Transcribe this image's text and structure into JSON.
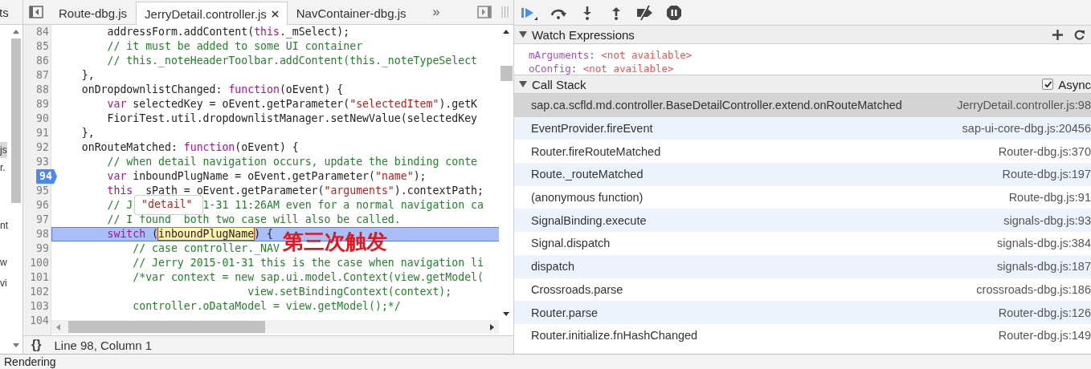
{
  "navigator": {
    "tab": "ts",
    "items": [
      {
        "label": "js",
        "selected": true
      },
      {
        "label": "r.",
        "selected": false
      },
      {
        "label": "nt",
        "selected": false
      },
      {
        "label": "w",
        "selected": false
      },
      {
        "label": "vi",
        "selected": false
      }
    ]
  },
  "tabs": [
    {
      "label": "Route-dbg.js",
      "selected": false,
      "closable": false
    },
    {
      "label": "JerryDetail.controller.js",
      "selected": true,
      "closable": true
    },
    {
      "label": "NavContainer-dbg.js",
      "selected": false,
      "closable": false
    }
  ],
  "tabs_overflow": "»",
  "code": {
    "lines": [
      {
        "number": "84",
        "breakpoint": false,
        "current": false,
        "tokens": [
          {
            "kind": "plain",
            "text": "        addressForm.addContent("
          },
          {
            "kind": "keyword",
            "text": "this"
          },
          {
            "kind": "plain",
            "text": "._mSelect);"
          }
        ]
      },
      {
        "number": "85",
        "breakpoint": false,
        "current": false,
        "tokens": [
          {
            "kind": "comment",
            "text": "        // it must be added to some UI container"
          }
        ]
      },
      {
        "number": "86",
        "breakpoint": false,
        "current": false,
        "tokens": [
          {
            "kind": "comment",
            "text": "        // this._noteHeaderToolbar.addContent(this._noteTypeSelect"
          }
        ]
      },
      {
        "number": "87",
        "breakpoint": false,
        "current": false,
        "tokens": [
          {
            "kind": "plain",
            "text": "    },"
          }
        ]
      },
      {
        "number": "88",
        "breakpoint": false,
        "current": false,
        "tokens": [
          {
            "kind": "plain",
            "text": "    onDropdownlistChanged: "
          },
          {
            "kind": "keyword",
            "text": "function"
          },
          {
            "kind": "plain",
            "text": "(oEvent) {"
          }
        ]
      },
      {
        "number": "89",
        "breakpoint": false,
        "current": false,
        "tokens": [
          {
            "kind": "keyword",
            "text": "        var"
          },
          {
            "kind": "plain",
            "text": " selectedKey = oEvent.getParameter("
          },
          {
            "kind": "string",
            "text": "\"selectedItem\""
          },
          {
            "kind": "plain",
            "text": ").getK"
          }
        ]
      },
      {
        "number": "90",
        "breakpoint": false,
        "current": false,
        "tokens": [
          {
            "kind": "plain",
            "text": "        FioriTest.util.dropdownlistManager.setNewValue(selectedKey"
          }
        ]
      },
      {
        "number": "91",
        "breakpoint": false,
        "current": false,
        "tokens": [
          {
            "kind": "plain",
            "text": "    },"
          }
        ]
      },
      {
        "number": "92",
        "breakpoint": false,
        "current": false,
        "tokens": [
          {
            "kind": "plain",
            "text": "    onRouteMatched: "
          },
          {
            "kind": "keyword",
            "text": "function"
          },
          {
            "kind": "plain",
            "text": "(oEvent) {"
          }
        ]
      },
      {
        "number": "93",
        "breakpoint": false,
        "current": false,
        "tokens": [
          {
            "kind": "comment",
            "text": "        // when detail navigation occurs, update the binding conte"
          }
        ]
      },
      {
        "number": "94",
        "breakpoint": true,
        "current": false,
        "tokens": [
          {
            "kind": "keyword",
            "text": "        var"
          },
          {
            "kind": "plain",
            "text": " inboundPlugName = oEvent.getParameter("
          },
          {
            "kind": "string",
            "text": "\"name\""
          },
          {
            "kind": "plain",
            "text": ");"
          }
        ]
      },
      {
        "number": "95",
        "breakpoint": false,
        "current": false,
        "tokens": [
          {
            "kind": "keyword",
            "text": "        this"
          },
          {
            "kind": "plain",
            "text": "  sPath = oEvent.getParameter("
          },
          {
            "kind": "string",
            "text": "\"arguments\""
          },
          {
            "kind": "plain",
            "text": ").contextPath;"
          }
        ]
      },
      {
        "number": "96",
        "breakpoint": false,
        "current": false,
        "tokens": [
          {
            "kind": "comment",
            "text": "        // J"
          },
          {
            "kind": "comment",
            "text": "1-31 11:26AM even for a normal navigation ca",
            "after_gap": true
          }
        ]
      },
      {
        "number": "97",
        "breakpoint": false,
        "current": false,
        "tokens": [
          {
            "kind": "comment",
            "text": "        // I found  both two case will also be called."
          }
        ]
      },
      {
        "number": "98",
        "breakpoint": false,
        "current": true,
        "tokens": [
          {
            "kind": "keyword",
            "text": "        switch"
          },
          {
            "kind": "plain",
            "text": " ("
          },
          {
            "kind": "match",
            "text": "inboundPlugName"
          },
          {
            "kind": "plain",
            "text": ") {"
          }
        ]
      },
      {
        "number": "99",
        "breakpoint": false,
        "current": false,
        "tokens": [
          {
            "kind": "comment",
            "text": "            // case controller._NAV"
          }
        ]
      },
      {
        "number": "100",
        "breakpoint": false,
        "current": false,
        "tokens": [
          {
            "kind": "comment",
            "text": "            // Jerry 2015-01-31 this is the case when navigation li"
          }
        ]
      },
      {
        "number": "101",
        "breakpoint": false,
        "current": false,
        "tokens": [
          {
            "kind": "comment",
            "text": "            /*var context = new sap.ui.model.Context(view.getModel("
          }
        ]
      },
      {
        "number": "102",
        "breakpoint": false,
        "current": false,
        "tokens": [
          {
            "kind": "comment",
            "text": "                              view.setBindingContext(context);"
          }
        ]
      },
      {
        "number": "103",
        "breakpoint": false,
        "current": false,
        "tokens": [
          {
            "kind": "comment",
            "text": "            controller.oDataModel = view.getModel();*/"
          }
        ]
      },
      {
        "number": "104",
        "breakpoint": false,
        "current": false
      }
    ]
  },
  "tooltip": "\"detail\"",
  "annotation": "第三次触发",
  "status_bar": {
    "format_button": "{}",
    "position": "Line 98, Column 1"
  },
  "drawer_tab": "Rendering",
  "watch": {
    "title": "Watch Expressions",
    "items": [
      {
        "name": "mArguments",
        "separator": ":",
        "value": "<not available>"
      },
      {
        "name": "oConfig",
        "separator": ":",
        "value": "<not available>"
      }
    ]
  },
  "call_stack": {
    "title": "Call Stack",
    "async_label": "Async",
    "async_checked": true,
    "frames": [
      {
        "function": "sap.ca.scfld.md.controller.BaseDetailController.extend.onRouteMatched",
        "location": "JerryDetail.controller.js:98",
        "selected": true
      },
      {
        "function": "EventProvider.fireEvent",
        "location": "sap-ui-core-dbg.js:20456",
        "selected": false
      },
      {
        "function": "Router.fireRouteMatched",
        "location": "Router-dbg.js:370",
        "selected": false
      },
      {
        "function": "Route._routeMatched",
        "location": "Route-dbg.js:197",
        "selected": false
      },
      {
        "function": "(anonymous function)",
        "location": "Route-dbg.js:91",
        "selected": false
      },
      {
        "function": "SignalBinding.execute",
        "location": "signals-dbg.js:93",
        "selected": false
      },
      {
        "function": "Signal.dispatch",
        "location": "signals-dbg.js:384",
        "selected": false
      },
      {
        "function": "dispatch",
        "location": "signals-dbg.js:187",
        "selected": false
      },
      {
        "function": "Crossroads.parse",
        "location": "crossroads-dbg.js:186",
        "selected": false
      },
      {
        "function": "Router.parse",
        "location": "Router-dbg.js:126",
        "selected": false
      },
      {
        "function": "Router.initialize.fnHashChanged",
        "location": "Router-dbg.js:149",
        "selected": false
      }
    ]
  }
}
